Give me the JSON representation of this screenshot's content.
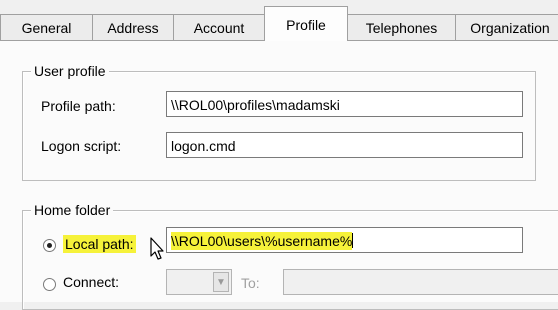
{
  "tabs": [
    {
      "label": "General",
      "active": false
    },
    {
      "label": "Address",
      "active": false
    },
    {
      "label": "Account",
      "active": false
    },
    {
      "label": "Profile",
      "active": true
    },
    {
      "label": "Telephones",
      "active": false
    },
    {
      "label": "Organization",
      "active": false
    }
  ],
  "user_profile": {
    "title": "User profile",
    "profile_path_label": "Profile path:",
    "profile_path_value": "\\\\ROL00\\profiles\\madamski",
    "logon_script_label": "Logon script:",
    "logon_script_value": "logon.cmd"
  },
  "home_folder": {
    "title": "Home folder",
    "local_path_label": "Local path:",
    "local_path_value": "\\\\ROL00\\users\\%username%",
    "local_path_selected": true,
    "connect_label": "Connect:",
    "connect_selected": false,
    "to_label": "To:"
  },
  "colors": {
    "highlight": "#f6f23a",
    "panel_bg": "#fbfbfb"
  }
}
